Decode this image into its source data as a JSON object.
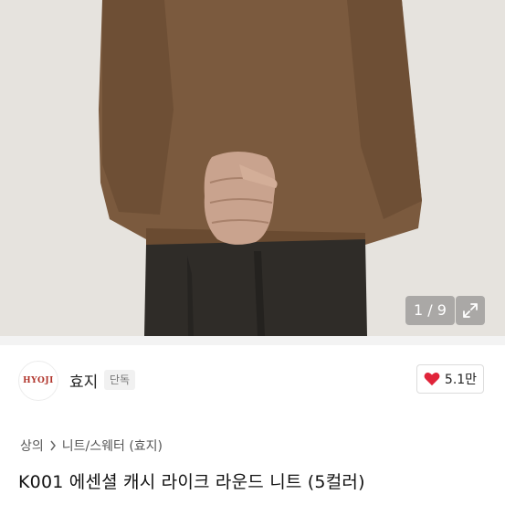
{
  "gallery": {
    "counter": "1 / 9",
    "expand_icon": "expand-icon"
  },
  "shop": {
    "logo_text": "HYOJI",
    "name": "효지",
    "badge": "단독"
  },
  "like": {
    "icon": "heart-icon",
    "icon_color": "#e0243a",
    "count": "5.1만"
  },
  "breadcrumb": {
    "level1": "상의",
    "separator_icon": "chevron-right-icon",
    "level2": "니트/스웨터 (효지)"
  },
  "product": {
    "title": "K001 에센셜 캐시 라이크 라운드 니트 (5컬러)"
  }
}
